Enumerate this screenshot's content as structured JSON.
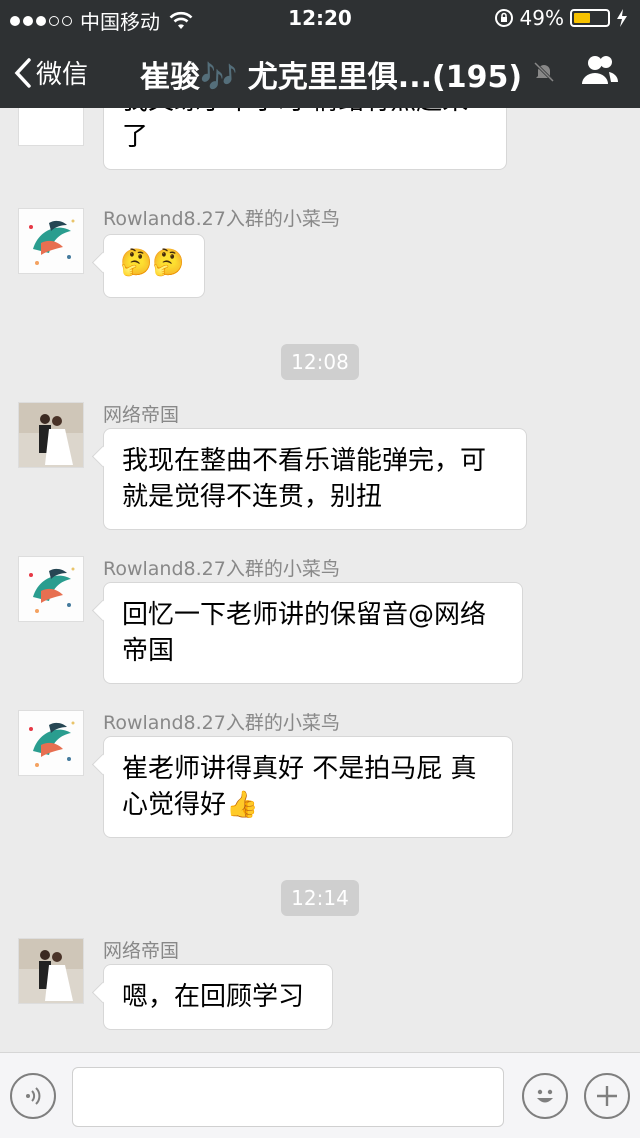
{
  "status_bar": {
    "carrier": "中国移动",
    "time": "12:20",
    "battery": "49%",
    "battery_level": 0.49,
    "signal_bars": 3,
    "signal_total": 5
  },
  "nav": {
    "back_label": "微信",
    "title": "崔骏🎶 尤克里里俱...(195)"
  },
  "chat": {
    "top_partial": {
      "text": "我又练了半小时 情绪有点起来了"
    },
    "messages": [
      {
        "sender": "Rowland8.27入群的小菜鸟",
        "text": "🤔🤔"
      },
      {
        "sender": "网络帝国",
        "text": "我现在整曲不看乐谱能弹完，可就是觉得不连贯，别扭"
      },
      {
        "sender": "Rowland8.27入群的小菜鸟",
        "text": "回忆一下老师讲的保留音@网络帝国"
      },
      {
        "sender": "Rowland8.27入群的小菜鸟",
        "text": "崔老师讲得真好 不是拍马屁 真心觉得好👍"
      },
      {
        "sender": "网络帝国",
        "text": "嗯，在回顾学习"
      }
    ],
    "timestamps": [
      "12:08",
      "12:14"
    ]
  },
  "input_bar": {
    "voice_icon": "voice-icon",
    "emoji_icon": "emoji-icon",
    "plus_icon": "plus-icon"
  },
  "colors": {
    "header_bg": "#2e3133",
    "chat_bg": "#ebebeb",
    "battery_fill": "#f7c200"
  }
}
